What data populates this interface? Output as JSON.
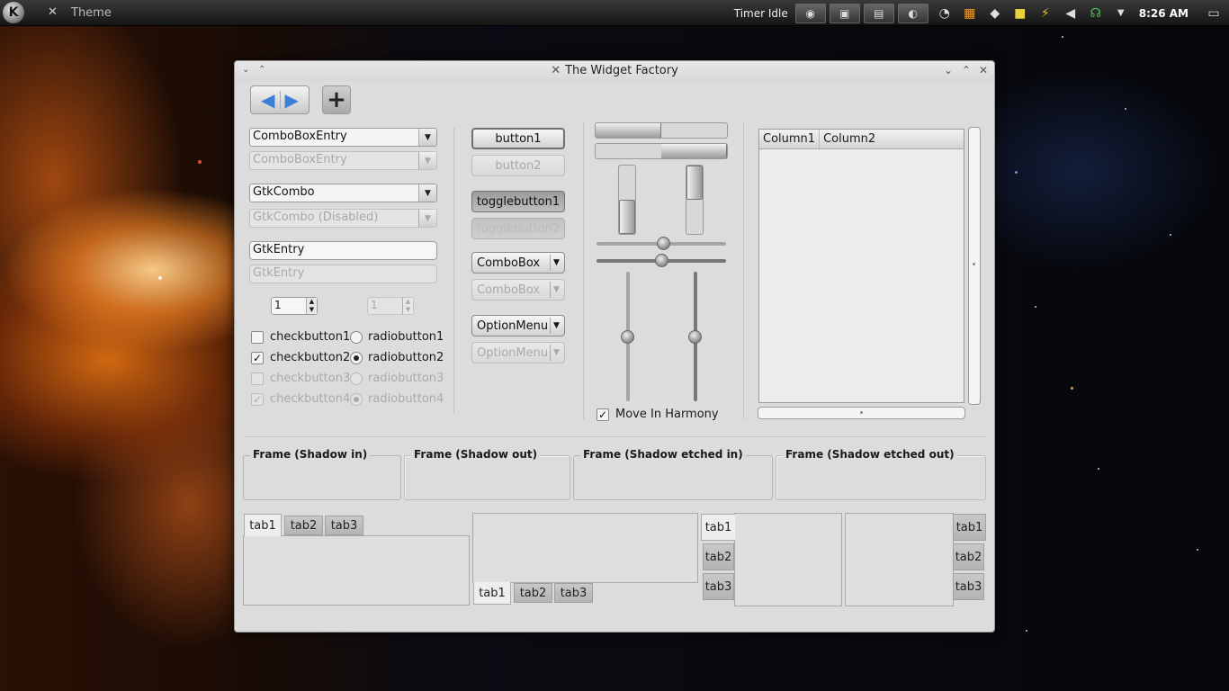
{
  "panel": {
    "kmenu_icon": "kde-k-icon",
    "task_label": "Theme",
    "timer_label": "Timer Idle",
    "clock": "8:26 AM",
    "tray_icons": [
      "firefox-icon",
      "clipboard-icon",
      "window-icon",
      "network-icon",
      "gauge-icon",
      "calendar-icon",
      "shield-icon",
      "note-icon",
      "power-icon",
      "volume-icon",
      "wifi-icon",
      "chevron-down-icon"
    ]
  },
  "window": {
    "title": "The Widget Factory",
    "title_icon": "tools-icon"
  },
  "left": {
    "combo_entry": "ComboBoxEntry",
    "combo_entry_disabled": "ComboBoxEntry",
    "gtkcombo": "GtkCombo",
    "gtkcombo_disabled": "GtkCombo (Disabled)",
    "entry": "GtkEntry",
    "entry_disabled": "GtkEntry",
    "spin1": "1",
    "spin2": "1",
    "check1": "checkbutton1",
    "check2": "checkbutton2",
    "check3": "checkbutton3",
    "check4": "checkbutton4",
    "radio1": "radiobutton1",
    "radio2": "radiobutton2",
    "radio3": "radiobutton3",
    "radio4": "radiobutton4"
  },
  "buttons": {
    "button1": "button1",
    "button2": "button2",
    "toggle1": "togglebutton1",
    "toggle2": "togglebutton2",
    "combobox": "ComboBox",
    "combobox_disabled": "ComboBox",
    "optionmenu": "OptionMenu",
    "optionmenu_disabled": "OptionMenu"
  },
  "ranges": {
    "hprogress1": 0.5,
    "hprogress2": 0.5,
    "vprogress1": 0.5,
    "vprogress2": 0.5,
    "hscale1": 0.52,
    "hscale2": 0.5,
    "vscale1": 0.5,
    "vscale2": 0.5,
    "harmony_label": "Move In Harmony"
  },
  "tree": {
    "columns": [
      "Column1",
      "Column2"
    ]
  },
  "frames": {
    "shadow_in": "Frame (Shadow in)",
    "shadow_out": "Frame (Shadow out)",
    "etched_in": "Frame (Shadow etched in)",
    "etched_out": "Frame (Shadow etched out)"
  },
  "notebooks": {
    "tabs": [
      "tab1",
      "tab2",
      "tab3"
    ]
  }
}
